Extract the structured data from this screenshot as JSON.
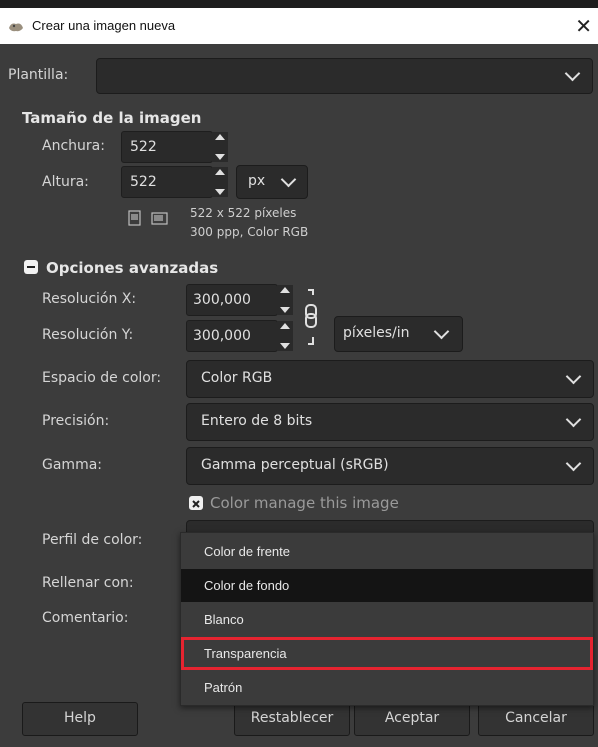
{
  "window": {
    "title": "Crear una imagen nueva",
    "close_glyph": "✕"
  },
  "template": {
    "label": "Plantilla:",
    "value": ""
  },
  "image_size": {
    "header": "Tamaño de la imagen",
    "width_label": "Anchura:",
    "width_value": "522",
    "height_label": "Altura:",
    "height_value": "522",
    "unit": "px",
    "info_line1": "522 x 522 píxeles",
    "info_line2": "300 ppp, Color RGB"
  },
  "advanced": {
    "header": "Opciones avanzadas",
    "res_x_label": "Resolución X:",
    "res_x_value": "300,000",
    "res_y_label": "Resolución Y:",
    "res_y_value": "300,000",
    "res_unit": "píxeles/in",
    "color_space_label": "Espacio de color:",
    "color_space_value": "Color RGB",
    "precision_label": "Precisión:",
    "precision_value": "Entero de 8 bits",
    "gamma_label": "Gamma:",
    "gamma_value": "Gamma perceptual (sRGB)",
    "color_manage_label": "Color manage this image",
    "color_profile_label": "Perfil de color:",
    "fill_label": "Rellenar con:",
    "comment_label": "Comentario:"
  },
  "fill_menu": {
    "items": [
      "Color de frente",
      "Color de fondo",
      "Blanco",
      "Transparencia",
      "Patrón"
    ],
    "selected_index": 1,
    "highlighted_index": 3
  },
  "buttons": {
    "help": "Help",
    "reset": "Restablecer",
    "ok": "Aceptar",
    "cancel": "Cancelar"
  },
  "colors": {
    "highlight_border": "#e52430",
    "background": "#3c3c3c"
  }
}
